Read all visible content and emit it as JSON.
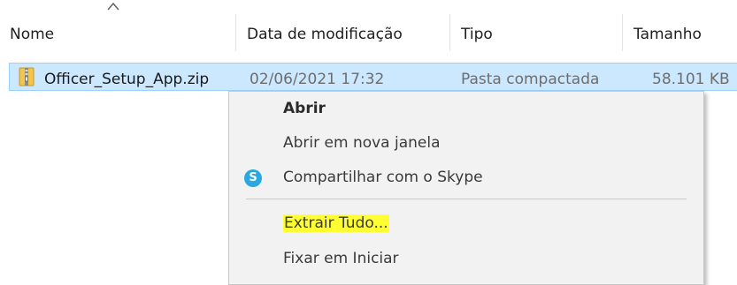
{
  "columns": {
    "name": "Nome",
    "modified": "Data de modificação",
    "type": "Tipo",
    "size": "Tamanho"
  },
  "file": {
    "name": "Officer_Setup_App.zip",
    "modified": "02/06/2021 17:32",
    "type": "Pasta compactada",
    "size": "58.101 KB",
    "icon": "zip-folder-icon"
  },
  "context_menu": {
    "open": "Abrir",
    "open_new_window": "Abrir em nova janela",
    "share_skype": "Compartilhar com o Skype",
    "skype_icon_letter": "S",
    "extract_all": "Extrair Tudo...",
    "pin_start": "Fixar em Iniciar"
  },
  "colors": {
    "selection_bg": "#cce8ff",
    "selection_border": "#99d1ff",
    "menu_bg": "#f2f2f2",
    "highlight": "#ffff33",
    "skype_blue": "#2aa8e0"
  }
}
